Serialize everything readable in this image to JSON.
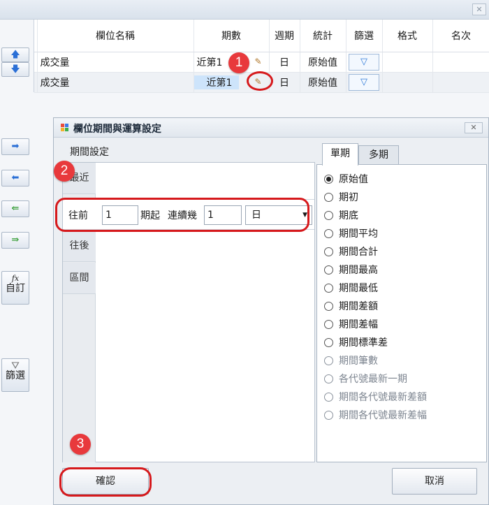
{
  "window": {
    "close_glyph": "✕"
  },
  "toolbar": {
    "up_glyph": "🡅",
    "down_glyph": "🡇",
    "right_glyph": "➡",
    "left_glyph": "⬅",
    "dbl_left_glyph": "⇚",
    "dbl_right_glyph": "⇛",
    "custom_fx": "fx",
    "custom_label": "自訂",
    "filter_glyph": "⛛",
    "filter_label": "篩選"
  },
  "grid": {
    "headers": [
      "",
      "欄位名稱",
      "期數",
      "週期",
      "統計",
      "篩選",
      "格式",
      "名次"
    ],
    "rows": [
      {
        "name": "成交量",
        "period": "近第1",
        "cycle": "日",
        "stat": "原始值"
      },
      {
        "name": "成交量",
        "period": "近第1",
        "cycle": "日",
        "stat": "原始值"
      }
    ]
  },
  "badges": [
    "1",
    "2",
    "3"
  ],
  "colors": {
    "badge": "#e8393c",
    "highlight": "#d6191c",
    "accent": "#2f7ad8"
  },
  "dialog": {
    "title": "欄位期間與運算設定",
    "close_glyph": "✕",
    "period_caption": "期間設定",
    "vtabs": [
      "最近",
      "往前",
      "往後",
      "區間"
    ],
    "front_row": {
      "prefix": "往前",
      "from_value": "1",
      "from_suffix": "期起",
      "consecutive_label": "連續幾",
      "count_value": "1",
      "unit_value": "日",
      "arrow": "▼"
    },
    "tabs": [
      "單期",
      "多期"
    ],
    "options": [
      {
        "label": "原始值",
        "checked": true
      },
      {
        "label": "期初"
      },
      {
        "label": "期底"
      },
      {
        "label": "期間平均"
      },
      {
        "label": "期間合計"
      },
      {
        "label": "期間最高"
      },
      {
        "label": "期間最低"
      },
      {
        "label": "期間差額"
      },
      {
        "label": "期間差幅"
      },
      {
        "label": "期間標準差"
      },
      {
        "label": "期間筆數",
        "dim": true
      },
      {
        "label": "各代號最新一期",
        "dim": true
      },
      {
        "label": "期間各代號最新差額",
        "dim": true
      },
      {
        "label": "期間各代號最新差幅",
        "dim": true
      }
    ],
    "confirm_label": "確認",
    "cancel_label": "取消"
  }
}
